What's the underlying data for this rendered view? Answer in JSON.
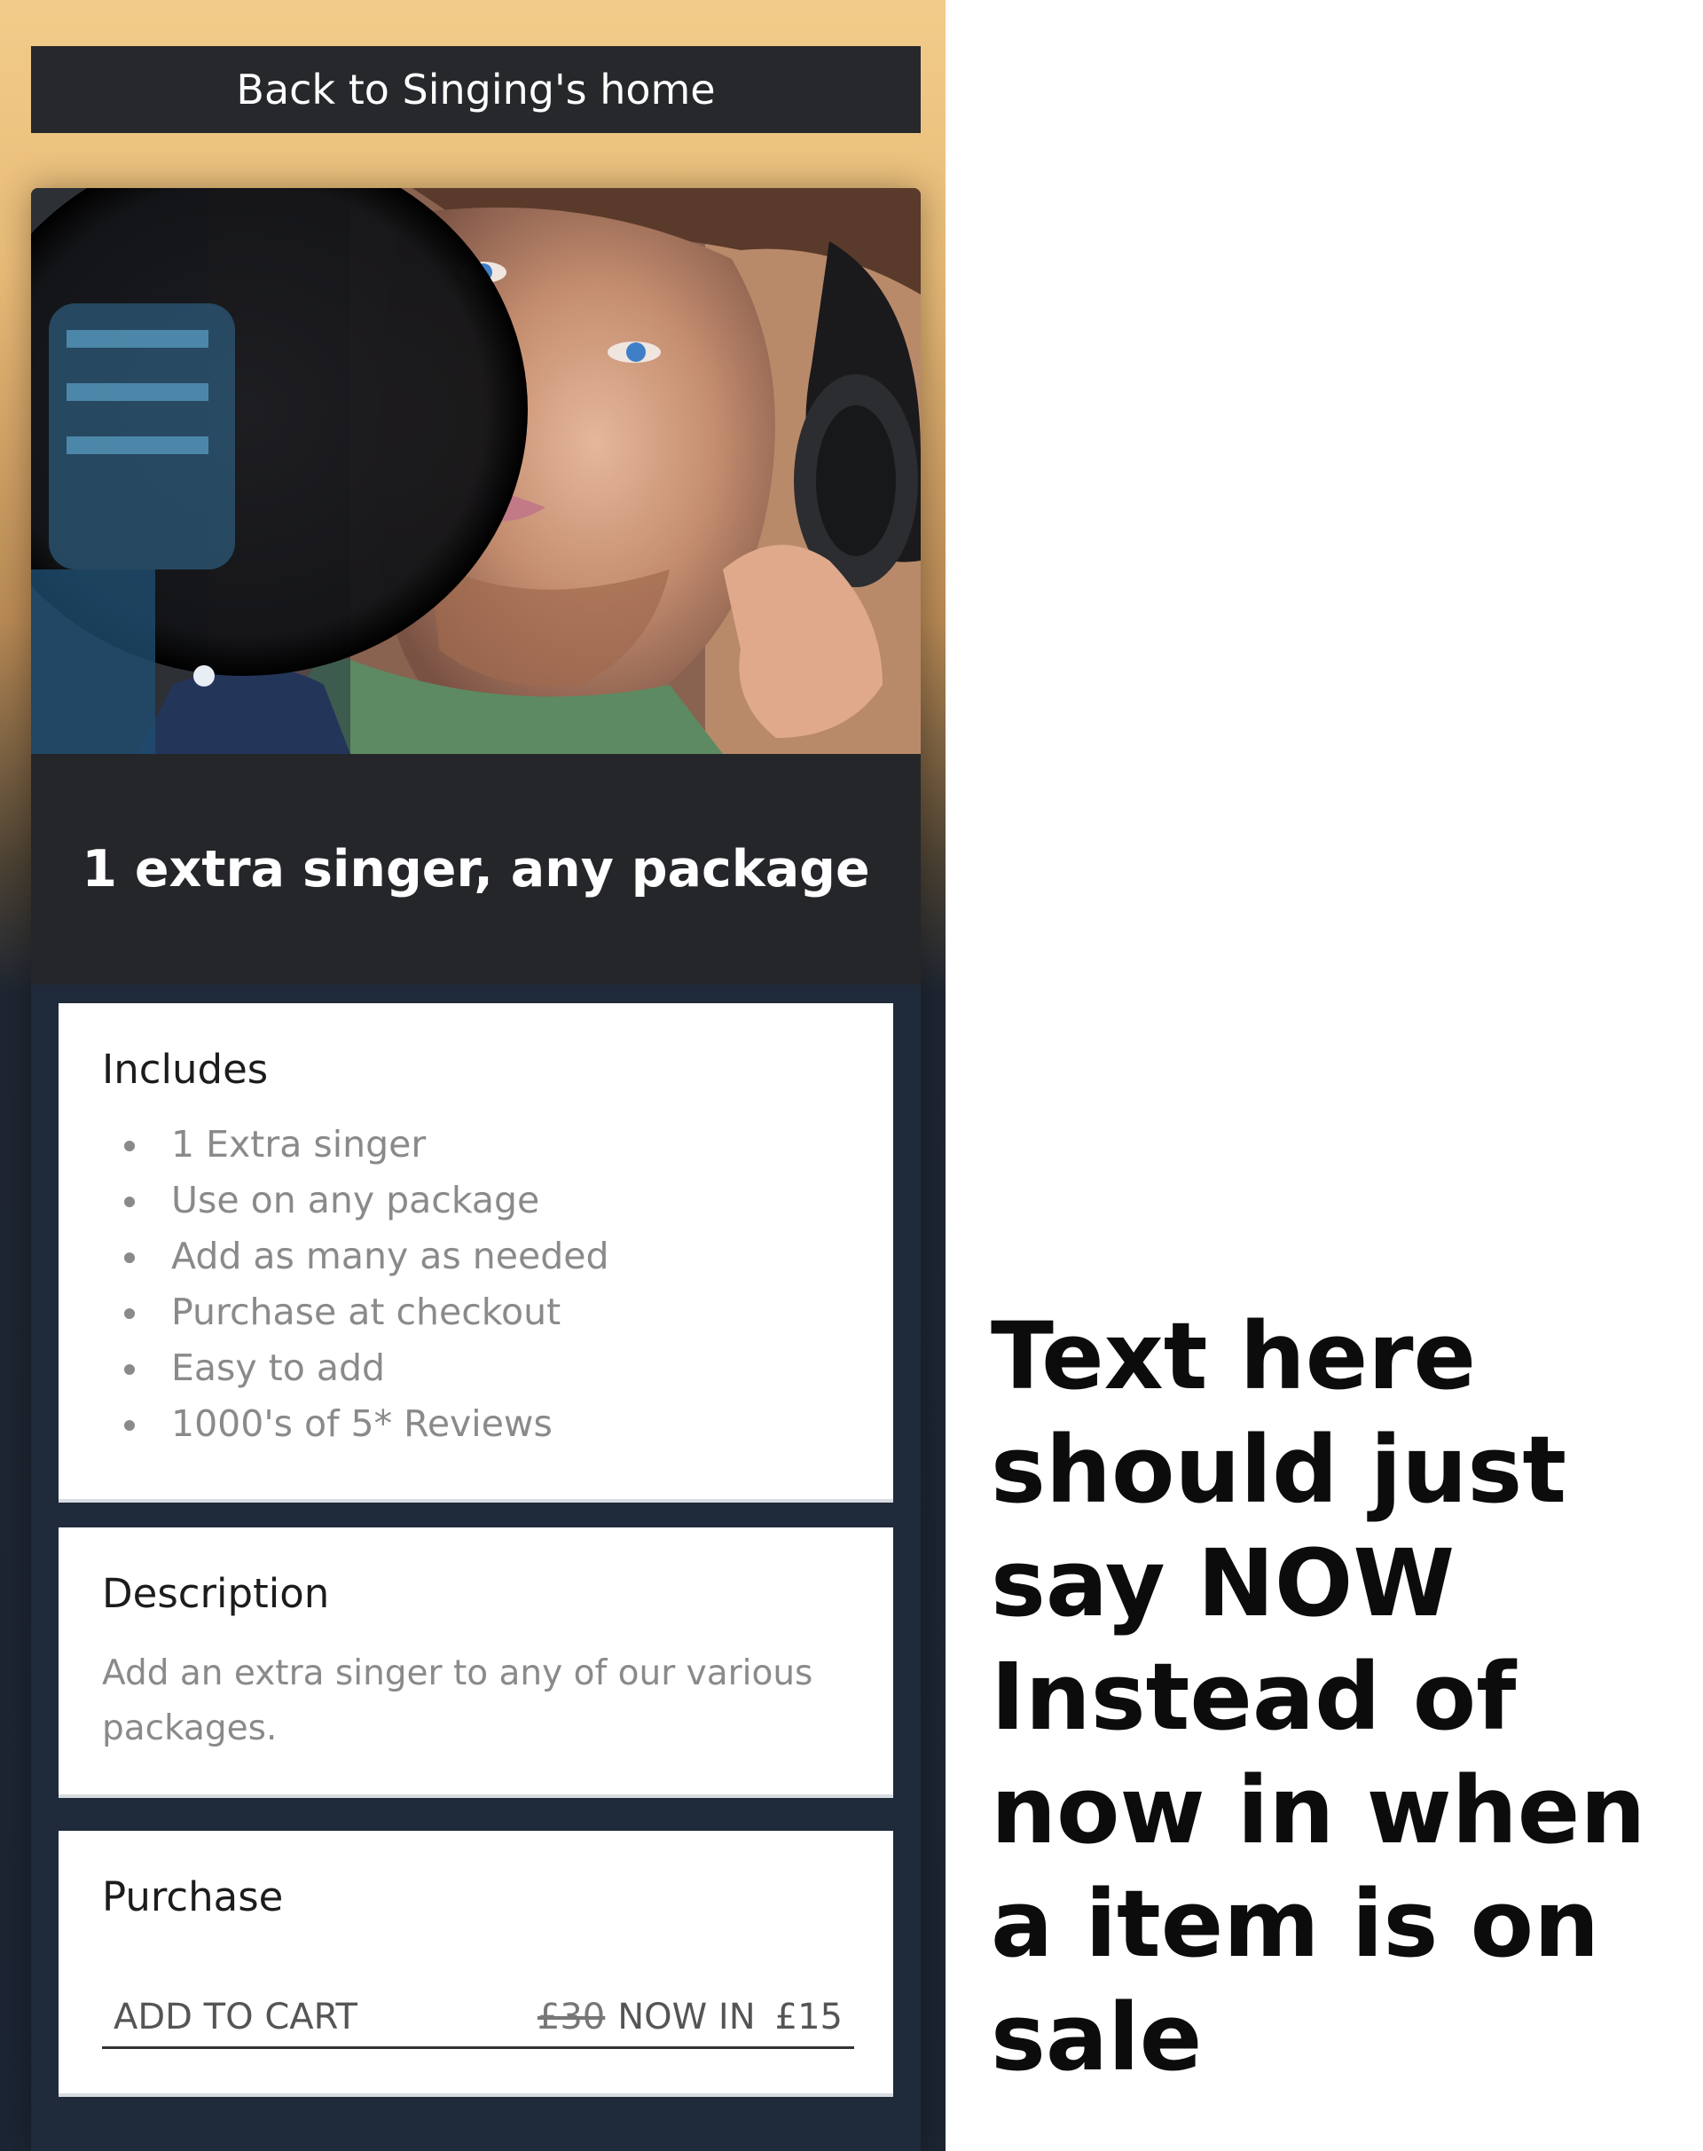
{
  "header": {
    "back_label": "Back to Singing's home"
  },
  "product": {
    "title": "1 extra singer, any package",
    "image_alt": "Singer with headphones at studio microphone"
  },
  "includes": {
    "heading": "Includes",
    "items": [
      "1 Extra singer",
      "Use on any package",
      "Add as many as needed",
      "Purchase at checkout",
      "Easy to add",
      "1000's of 5* Reviews"
    ]
  },
  "description": {
    "heading": "Description",
    "text": "Add an extra singer to any of our various packages."
  },
  "purchase": {
    "heading": "Purchase",
    "add_to_cart_label": "ADD TO CART",
    "old_price": "£30",
    "now_label": "NOW IN",
    "new_price": "£15"
  },
  "annotation": {
    "text": "Text here should just say NOW Instead of now in when a item is on sale"
  },
  "colors": {
    "dark_band": "#242629",
    "card_bg": "#1f2a3a",
    "panel_bg": "#ffffff",
    "muted_text": "#8a8a8a"
  },
  "icons": [
    "bullet-dot"
  ]
}
